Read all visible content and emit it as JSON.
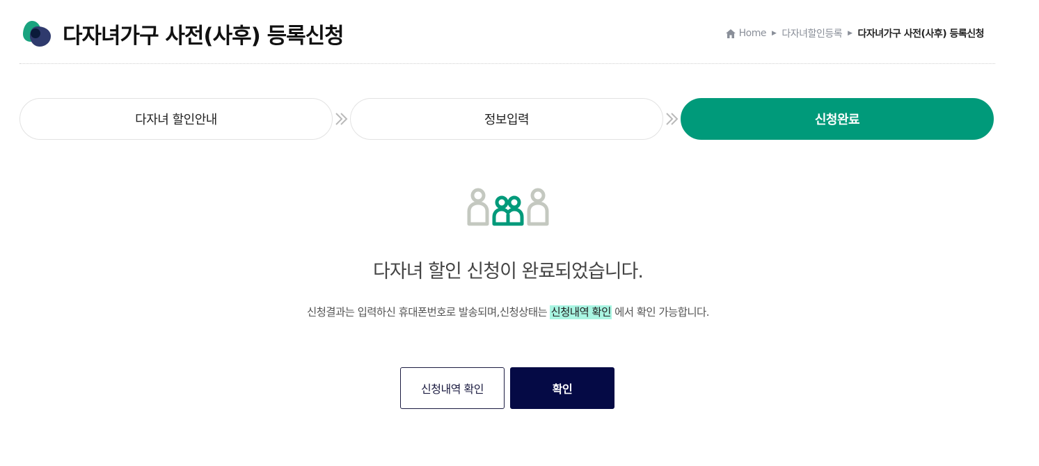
{
  "header": {
    "title": "다자녀가구 사전(사후) 등록신청",
    "logo_icon": "leaf-logo-icon",
    "breadcrumb": {
      "home": "Home",
      "items": [
        "다자녀할인등록",
        "다자녀가구 사전(사후) 등록신청"
      ],
      "separator_icon": "triangle-right-icon"
    }
  },
  "steps": [
    {
      "label": "다자녀 할인안내",
      "active": false
    },
    {
      "label": "정보입력",
      "active": false
    },
    {
      "label": "신청완료",
      "active": true
    }
  ],
  "result": {
    "icon": "family-people-icon",
    "message": "다자녀 할인 신청이 완료되었습니다.",
    "sub_before": "신청결과는 입력하신 휴대폰번호로 발송되며,신청상태는 ",
    "sub_highlight": "신청내역 확인",
    "sub_after": " 에서 확인 가능합니다."
  },
  "buttons": {
    "history_label": "신청내역 확인",
    "confirm_label": "확인"
  },
  "colors": {
    "accent": "#009a7a",
    "primary_button": "#050a45",
    "highlight": "#a9f5e2",
    "icon_gray": "#c4c8c0"
  }
}
